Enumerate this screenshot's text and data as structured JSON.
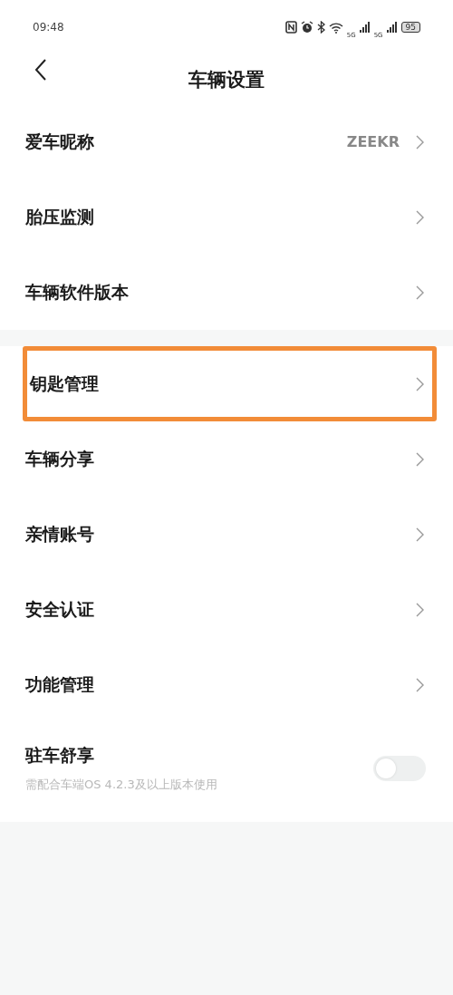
{
  "status_bar": {
    "time": "09:48",
    "network_1": "5G",
    "network_2": "5G",
    "battery": "95"
  },
  "header": {
    "title": "车辆设置"
  },
  "sections": [
    {
      "items": [
        {
          "kind": "link",
          "label": "爱车昵称",
          "value": "ZEEKR",
          "highlighted": false
        },
        {
          "kind": "link",
          "label": "胎压监测",
          "highlighted": false
        },
        {
          "kind": "link",
          "label": "车辆软件版本",
          "highlighted": false
        }
      ]
    },
    {
      "items": [
        {
          "kind": "link",
          "label": "钥匙管理",
          "highlighted": true
        },
        {
          "kind": "link",
          "label": "车辆分享",
          "highlighted": false
        },
        {
          "kind": "link",
          "label": "亲情账号",
          "highlighted": false
        },
        {
          "kind": "link",
          "label": "安全认证",
          "highlighted": false
        },
        {
          "kind": "link",
          "label": "功能管理",
          "highlighted": false
        },
        {
          "kind": "toggle",
          "label": "驻车舒享",
          "subtitle": "需配合车端OS 4.2.3及以上版本使用",
          "on": false,
          "highlighted": false
        }
      ]
    }
  ]
}
